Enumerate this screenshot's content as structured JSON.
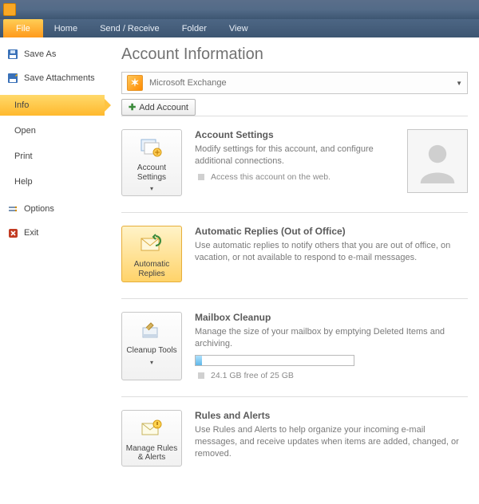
{
  "titlebar": {
    "text": ""
  },
  "tabs": {
    "file": "File",
    "home": "Home",
    "send_receive": "Send / Receive",
    "folder": "Folder",
    "view": "View"
  },
  "sidebar": {
    "save_as": "Save As",
    "save_attachments": "Save Attachments",
    "info": "Info",
    "open": "Open",
    "print": "Print",
    "help": "Help",
    "options": "Options",
    "exit": "Exit"
  },
  "page": {
    "title": "Account Information",
    "account_name": "Microsoft Exchange",
    "add_account": "Add Account"
  },
  "sections": {
    "account_settings": {
      "btn": "Account Settings",
      "title": "Account Settings",
      "desc": "Modify settings for this account, and configure additional connections.",
      "bullet": "Access this account on the web."
    },
    "auto_replies": {
      "btn": "Automatic Replies",
      "title": "Automatic Replies (Out of Office)",
      "desc": "Use automatic replies to notify others that you are out of office, on vacation, or not available to respond to e-mail messages."
    },
    "cleanup": {
      "btn": "Cleanup Tools",
      "title": "Mailbox Cleanup",
      "desc": "Manage the size of your mailbox by emptying Deleted Items and archiving.",
      "quota": "24.1 GB free of 25 GB"
    },
    "rules": {
      "btn": "Manage Rules & Alerts",
      "title": "Rules and Alerts",
      "desc": "Use Rules and Alerts to help organize your incoming e-mail messages, and receive updates when items are added, changed, or removed."
    }
  }
}
